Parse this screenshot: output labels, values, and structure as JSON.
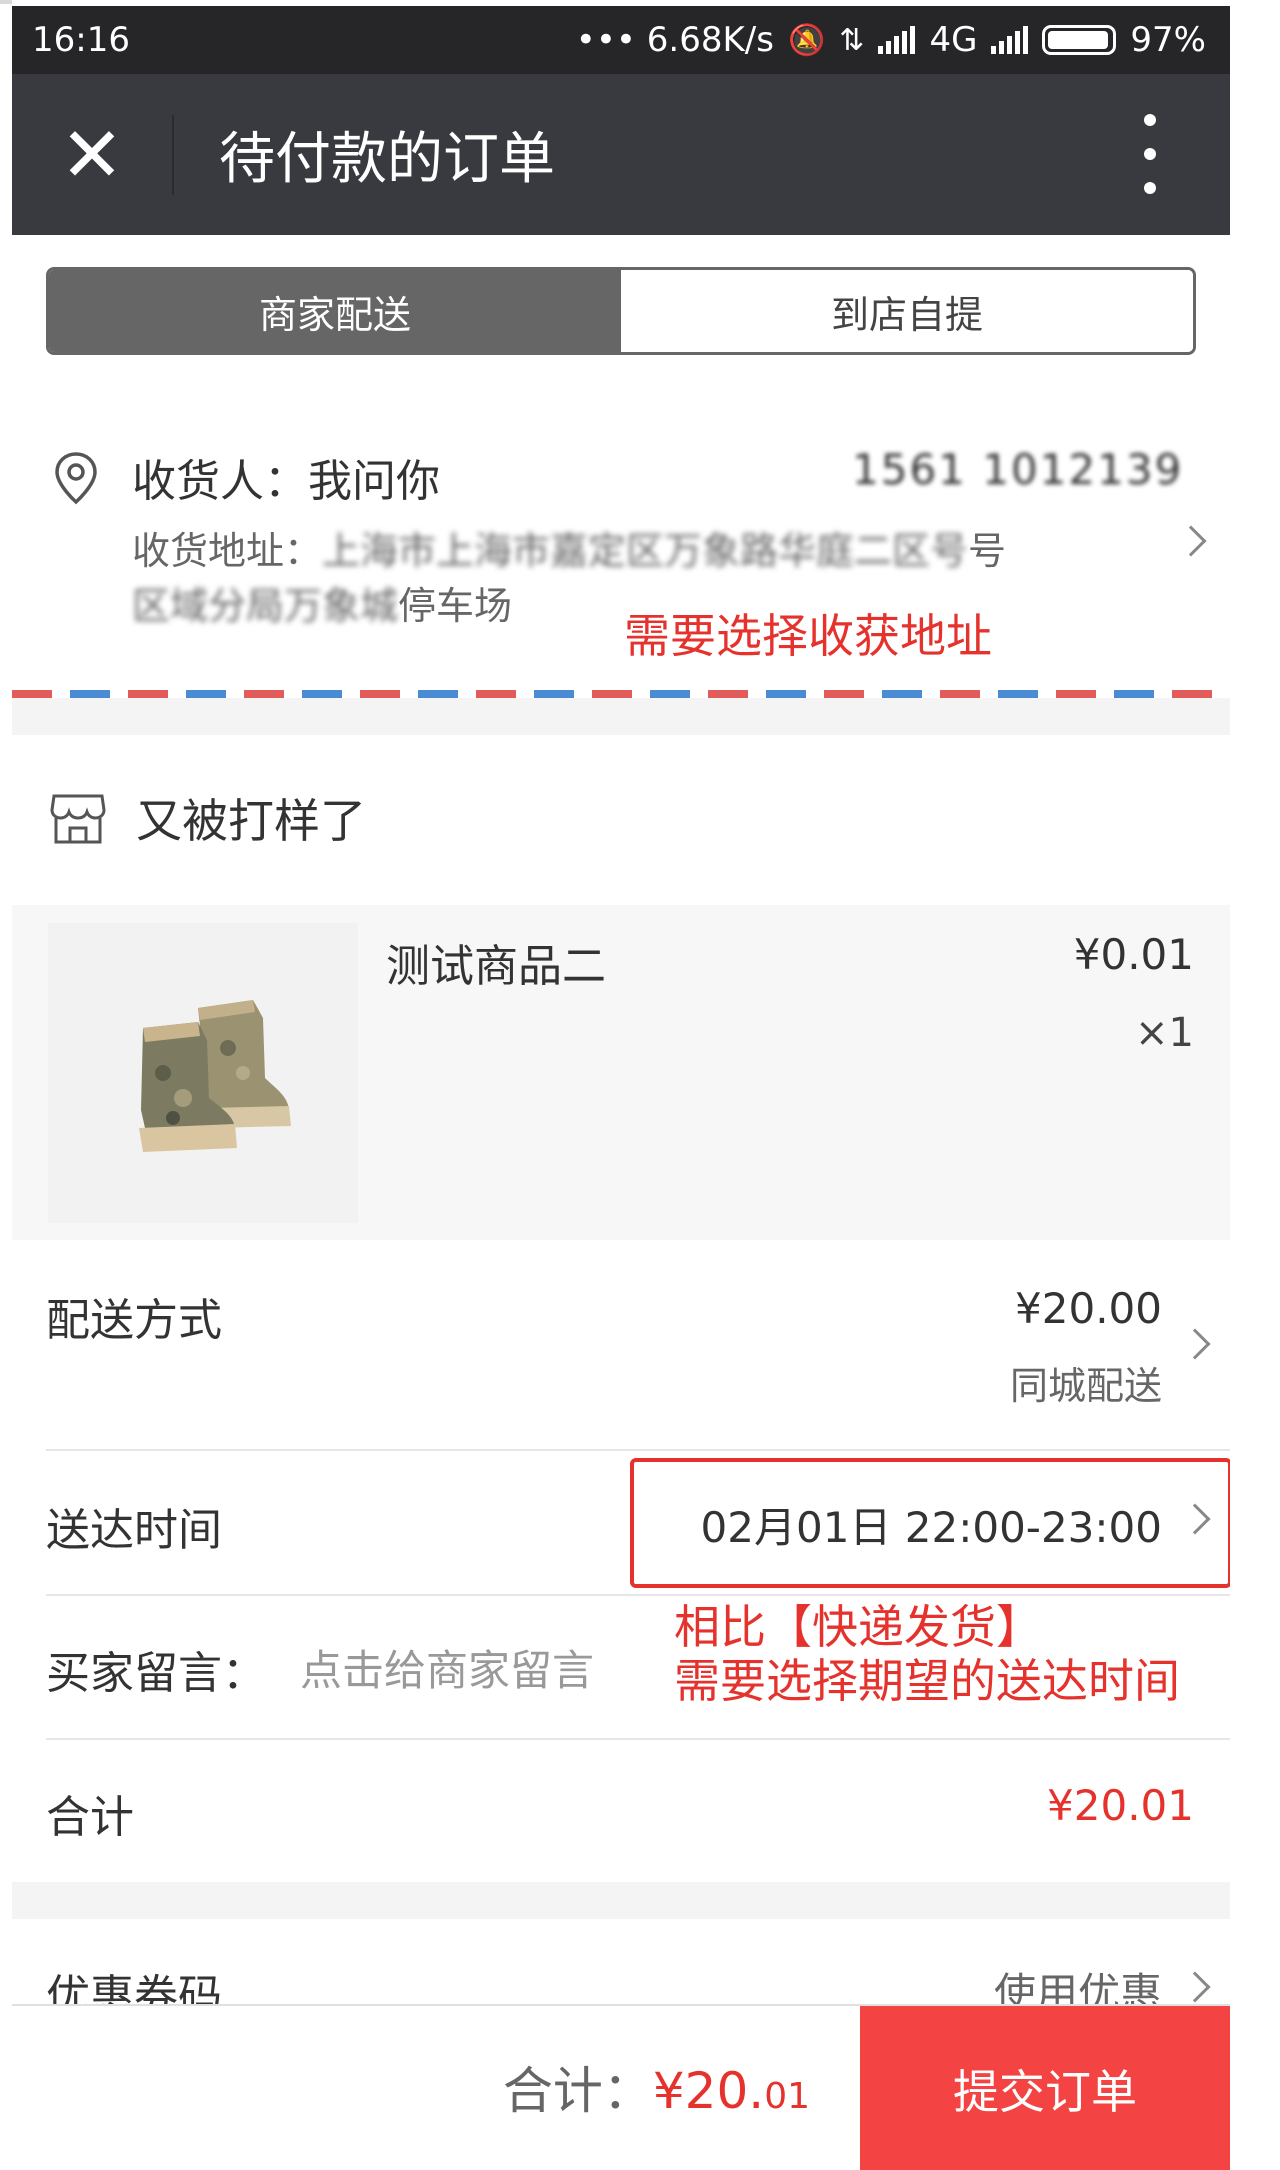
{
  "status_bar": {
    "time": "16:16",
    "speed": "••• 6.68K/s",
    "network": "4G",
    "battery": "97%"
  },
  "header": {
    "title": "待付款的订单",
    "close_icon": "close-icon",
    "more_icon": "more-vertical-icon"
  },
  "delivery_tabs": [
    {
      "label": "商家配送",
      "active": true
    },
    {
      "label": "到店自提",
      "active": false
    }
  ],
  "address": {
    "receiver": "收货人：我问你",
    "phone": "1561 1012139",
    "address_label": "收货地址：",
    "address_masked": "上海市上海市嘉定区万象路华庭二区号",
    "address_tail_1": "号",
    "address_line2_masked": "区域分局万象城",
    "address_tail_2": "停车场",
    "annotation": "需要选择收获地址"
  },
  "shop": {
    "name": "又被打样了",
    "icon": "shop-icon"
  },
  "product": {
    "name": "测试商品二",
    "price": "¥0.01",
    "quantity": "×1",
    "image": "boots-image"
  },
  "shipping": {
    "label": "配送方式",
    "fee": "¥20.00",
    "method": "同城配送"
  },
  "delivery_time": {
    "label": "送达时间",
    "value": "02月01日 22:00-23:00",
    "annotation_line1": "相比【快递发货】",
    "annotation_line2": "需要选择期望的送达时间"
  },
  "buyer_message": {
    "label": "买家留言：",
    "placeholder": "点击给商家留言"
  },
  "subtotal": {
    "label": "合计",
    "value": "¥20.01"
  },
  "coupon": {
    "label": "优惠券码",
    "action": "使用优惠"
  },
  "bottom_bar": {
    "total_label": "合计：",
    "total_main": "¥20.",
    "total_cents": "01",
    "submit_label": "提交订单"
  },
  "colors": {
    "accent_red": "#e5322d",
    "submit_red": "#f44343",
    "header_dark": "#393a3f"
  }
}
